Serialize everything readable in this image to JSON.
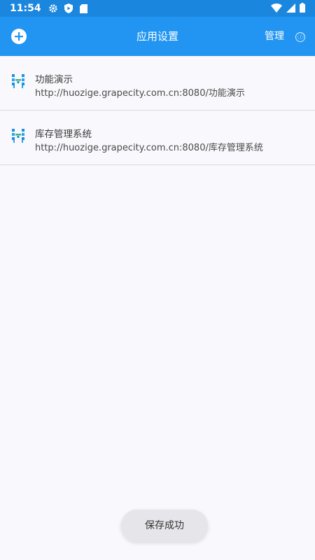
{
  "status_bar": {
    "time": "11:54",
    "icons": [
      "settings-gear-icon",
      "shield-icon",
      "sd-card-icon",
      "wifi-icon",
      "signal-icon",
      "battery-icon"
    ]
  },
  "app_bar": {
    "title": "应用设置",
    "manage_label": "管理",
    "info_icon": "ⓘ",
    "add_icon": "plus-circle-icon",
    "background_color": "#2195f1"
  },
  "apps": [
    {
      "name": "功能演示",
      "url": "http://huozige.grapecity.com.cn:8080/功能演示",
      "icon": "huozige-logo-icon"
    },
    {
      "name": "库存管理系统",
      "url": "http://huozige.grapecity.com.cn:8080/库存管理系统",
      "icon": "huozige-logo-icon"
    }
  ],
  "toast": {
    "message": "保存成功"
  }
}
